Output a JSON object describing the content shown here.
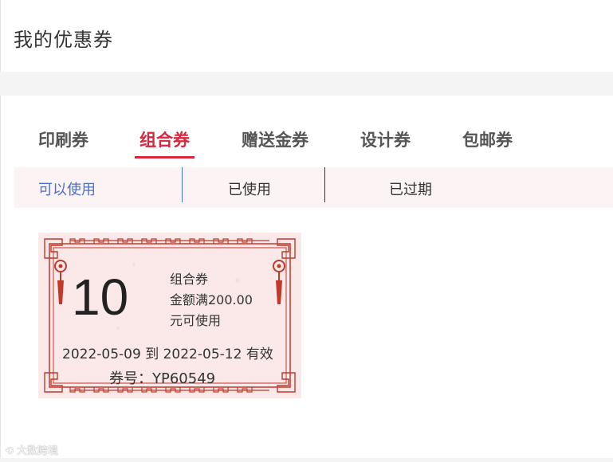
{
  "page": {
    "title": "我的优惠券"
  },
  "tabs": [
    {
      "label": "印刷券"
    },
    {
      "label": "组合券"
    },
    {
      "label": "赠送金券"
    },
    {
      "label": "设计券"
    },
    {
      "label": "包邮券"
    }
  ],
  "active_tab": "组合券",
  "subtabs": [
    {
      "label": "可以使用"
    },
    {
      "label": "已使用"
    },
    {
      "label": "已过期"
    }
  ],
  "active_subtab": "可以使用",
  "coupon": {
    "amount": "10",
    "type": "组合券",
    "condition": "金额满200.00",
    "condition_suffix": "元可使用",
    "validity": "2022-05-09 到 2022-05-12 有效",
    "code": "券号：YP60549"
  },
  "watermark": {
    "text": "大数跨境"
  },
  "colors": {
    "accent": "#d7263d",
    "subtab_active": "#4a6fd0",
    "subtab_bg": "#fcf4f4",
    "coupon_bg": "#fbe9e9",
    "coupon_frame": "#c0392b"
  }
}
